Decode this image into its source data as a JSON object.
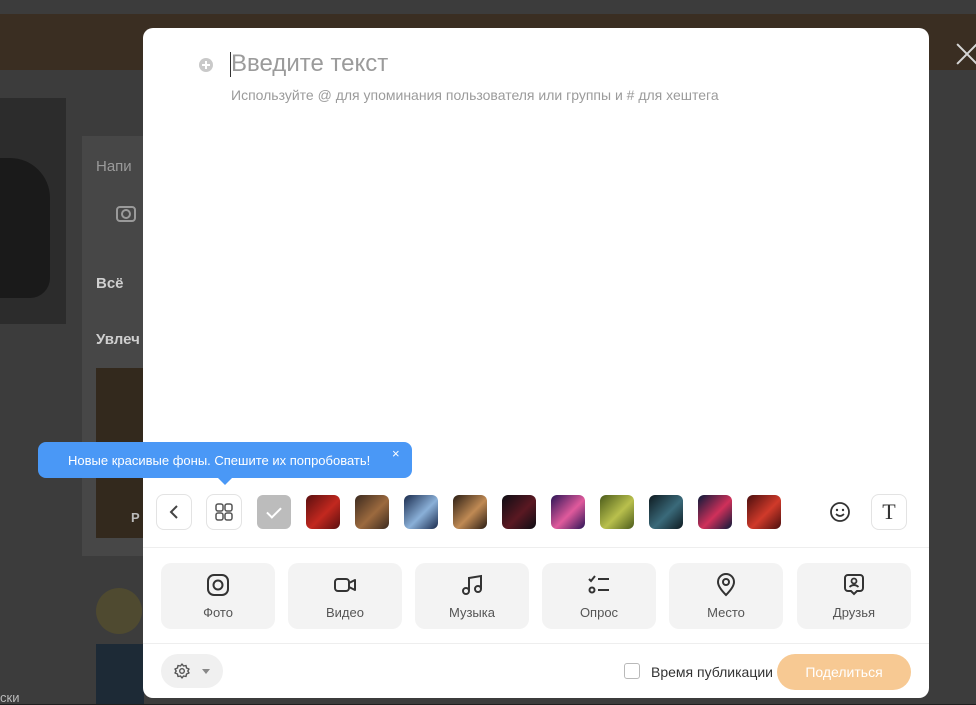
{
  "background": {
    "compose_placeholder_partial": "Напи",
    "filter_label_partial": "Всё",
    "section_title_partial": "Увлеч",
    "thumb_letter": "Р",
    "footer_text_partial": "ски"
  },
  "editor": {
    "placeholder": "Введите текст",
    "hint": "Используйте @ для упоминания пользователя или группы и # для хештега"
  },
  "tooltip": {
    "text": "Новые красивые фоны. Спешите их попробовать!",
    "close_glyph": "×"
  },
  "toolbar": {
    "text_style_glyph": "T",
    "backgrounds": [
      {
        "name": "red-abstract",
        "colors": [
          "#5a0f0f",
          "#c2281f"
        ]
      },
      {
        "name": "game-art-brown",
        "colors": [
          "#3b2a1f",
          "#9c6a3e"
        ]
      },
      {
        "name": "game-art-blue",
        "colors": [
          "#1a2b4d",
          "#8ab0d8"
        ]
      },
      {
        "name": "warrior-dark",
        "colors": [
          "#2a1d14",
          "#c08a54"
        ]
      },
      {
        "name": "suit-figure",
        "colors": [
          "#0d0d14",
          "#5a1822"
        ]
      },
      {
        "name": "purple-neon",
        "colors": [
          "#2a1456",
          "#e05a9c"
        ]
      },
      {
        "name": "camo-green",
        "colors": [
          "#4a5a1a",
          "#b9c04d"
        ]
      },
      {
        "name": "dark-teal",
        "colors": [
          "#0e1a20",
          "#3a6a7a"
        ]
      },
      {
        "name": "neon-hero",
        "colors": [
          "#0a1a3a",
          "#d0305a"
        ]
      },
      {
        "name": "red-character",
        "colors": [
          "#4a0e0e",
          "#d03a2a"
        ]
      }
    ]
  },
  "attachments": [
    {
      "key": "photo",
      "label": "Фото",
      "icon": "camera-icon"
    },
    {
      "key": "video",
      "label": "Видео",
      "icon": "video-camera-icon"
    },
    {
      "key": "music",
      "label": "Музыка",
      "icon": "music-note-icon"
    },
    {
      "key": "poll",
      "label": "Опрос",
      "icon": "poll-icon"
    },
    {
      "key": "place",
      "label": "Место",
      "icon": "location-pin-icon"
    },
    {
      "key": "friends",
      "label": "Друзья",
      "icon": "friend-badge-icon"
    }
  ],
  "footer": {
    "schedule_label": "Время публикации",
    "share_label": "Поделиться"
  },
  "colors": {
    "accent": "#f7c993",
    "tooltip": "#4a98f6"
  }
}
